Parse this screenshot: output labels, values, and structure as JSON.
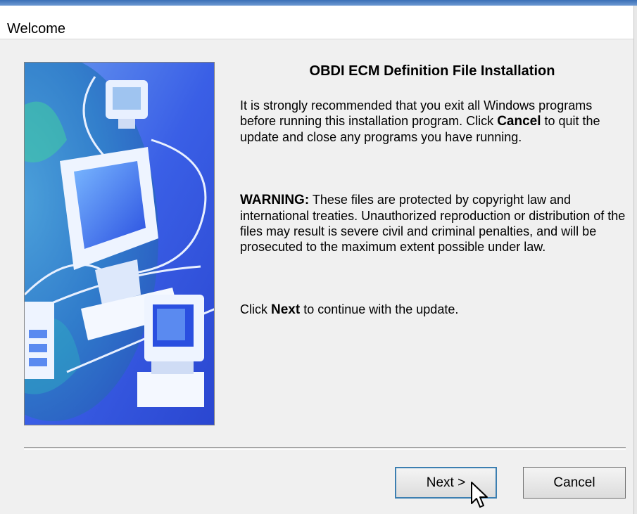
{
  "window": {
    "title": "Welcome"
  },
  "content": {
    "heading": "OBDI ECM Definition File Installation",
    "para1_a": "It is strongly recommended that you exit all Windows programs before running this installation program. Click ",
    "para1_bold": "Cancel",
    "para1_b": " to quit the update and close any programs you have running.",
    "para2_bold": "WARNING:",
    "para2_rest": " These files are protected by copyright law and international treaties.  Unauthorized reproduction or distribution of the files may result is severe civil and criminal penalties, and will be prosecuted to the maximum extent possible under law.",
    "para3_a": "Click ",
    "para3_bold": "Next",
    "para3_b": " to continue with the update."
  },
  "buttons": {
    "next_label": "Next >",
    "cancel_label": "Cancel"
  },
  "colors": {
    "panel_blue": "#3a63e0",
    "focus_border": "#3c7fb1"
  },
  "icons": {
    "illustration": "computer-network-illustration",
    "cursor": "mouse-pointer-icon"
  }
}
